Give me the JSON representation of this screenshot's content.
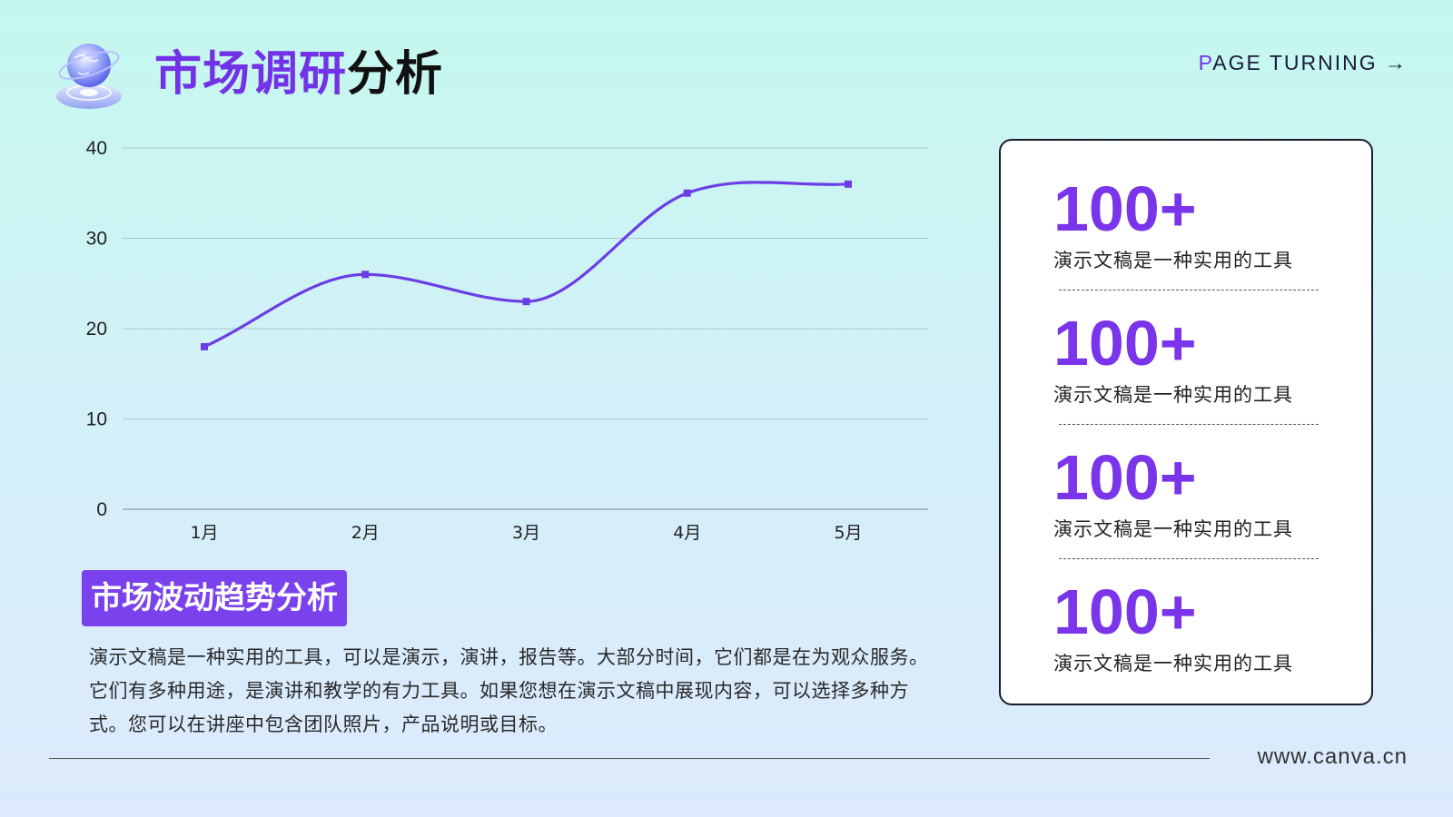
{
  "header": {
    "title_accent": "市场调研",
    "title_rest": "分析",
    "page_turning_first": "P",
    "page_turning_rest": "AGE TURNING →"
  },
  "logo": {
    "icon": "globe-icon"
  },
  "colors": {
    "accent": "#7232e6",
    "line": "#6b3de6",
    "grid": "#a9c9cf"
  },
  "chart_data": {
    "type": "line",
    "categories": [
      "1月",
      "2月",
      "3月",
      "4月",
      "5月"
    ],
    "series": [
      {
        "values": [
          18,
          26,
          23,
          35,
          36
        ]
      }
    ],
    "ylim": [
      0,
      40
    ],
    "yticks": [
      0,
      10,
      20,
      30,
      40
    ],
    "xlabel": "",
    "ylabel": "",
    "grid": true
  },
  "section": {
    "subtitle": "市场波动趋势分析",
    "description": "演示文稿是一种实用的工具，可以是演示，演讲，报告等。大部分时间，它们都是在为观众服务。它们有多种用途，是演讲和教学的有力工具。如果您想在演示文稿中展现内容，可以选择多种方式。您可以在讲座中包含团队照片，产品说明或目标。"
  },
  "stats": [
    {
      "value": "100+",
      "label": "演示文稿是一种实用的工具"
    },
    {
      "value": "100+",
      "label": "演示文稿是一种实用的工具"
    },
    {
      "value": "100+",
      "label": "演示文稿是一种实用的工具"
    },
    {
      "value": "100+",
      "label": "演示文稿是一种实用的工具"
    }
  ],
  "footer": {
    "site": "www.canva.cn"
  }
}
